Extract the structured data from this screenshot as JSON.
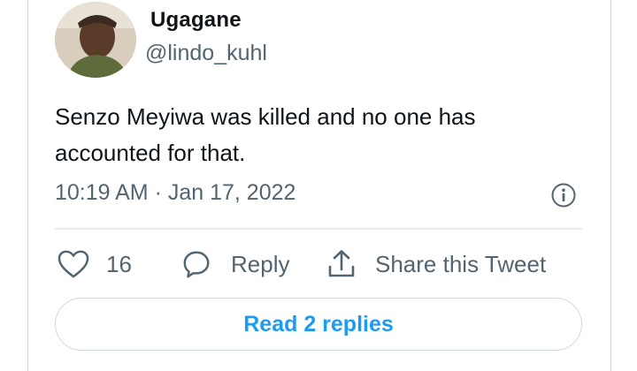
{
  "tweet": {
    "author": {
      "display_name": "Ugagane",
      "handle": "@lindo_kuhl",
      "avatar_icon": "profile-photo"
    },
    "text": "Senzo Meyiwa was killed and no one has accounted for that.",
    "timestamp": "10:19 AM · Jan 17, 2022",
    "info_icon": "info-icon"
  },
  "actions": {
    "like": {
      "icon": "heart-icon",
      "count": "16"
    },
    "reply": {
      "icon": "reply-bubble-icon",
      "label": "Reply"
    },
    "share": {
      "icon": "share-icon",
      "label": "Share this Tweet"
    }
  },
  "read_replies": {
    "label": "Read 2 replies"
  },
  "colors": {
    "accent": "#1d9bf0",
    "secondary_text": "#536471",
    "border": "#cfd9de"
  }
}
